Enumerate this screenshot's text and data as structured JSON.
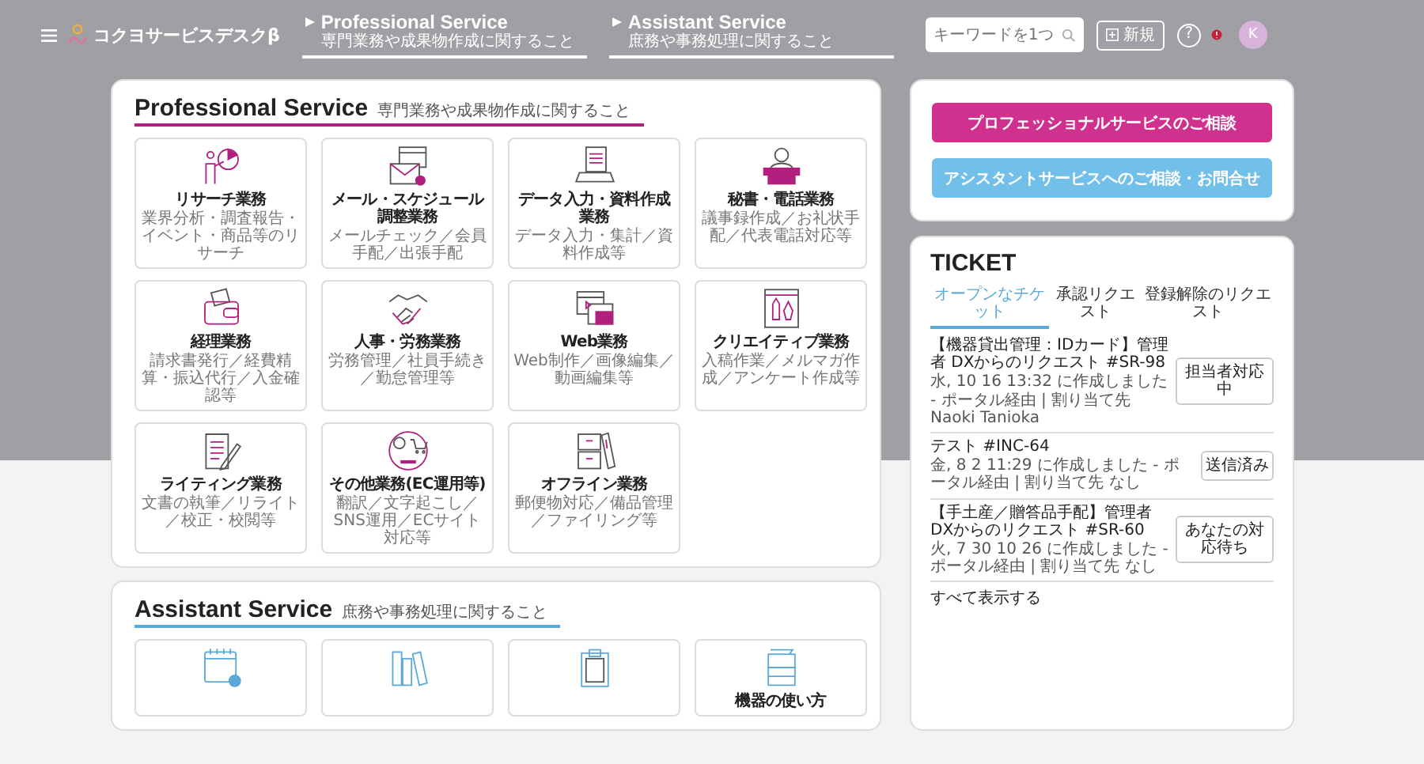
{
  "header": {
    "brand": "コクヨサービスデスクβ",
    "nav": [
      {
        "label": "Professional Service",
        "sub": "専門業務や成果物作成に関すること"
      },
      {
        "label": "Assistant Service",
        "sub": "庶務や事務処理に関すること"
      }
    ],
    "search": {
      "placeholder": "キーワードを1つ"
    },
    "new_button": "新規",
    "help": "?",
    "avatar": "K"
  },
  "sections": [
    {
      "title": "Professional Service",
      "sub": "専門業務や成果物作成に関すること",
      "color": "#b2207f",
      "cards": [
        {
          "kind": "research",
          "title": "リサーチ業務",
          "desc": "業界分析・調査報告・イベント・商品等のリサーチ"
        },
        {
          "kind": "mail",
          "title": "メール・スケジュール調整業務",
          "desc": "メールチェック／会員手配／出張手配"
        },
        {
          "kind": "data",
          "title": "データ入力・資料作成業務",
          "desc": "データ入力・集計／資料作成等"
        },
        {
          "kind": "secretary",
          "title": "秘書・電話業務",
          "desc": "議事録作成／お礼状手配／代表電話対応等"
        },
        {
          "kind": "accounting",
          "title": "経理業務",
          "desc": "請求書発行／経費精算・振込代行／入金確認等"
        },
        {
          "kind": "hr",
          "title": "人事・労務業務",
          "desc": "労務管理／社員手続き／勤怠管理等"
        },
        {
          "kind": "web",
          "title": "Web業務",
          "desc": "Web制作／画像編集／動画編集等"
        },
        {
          "kind": "creative",
          "title": "クリエイティブ業務",
          "desc": "入稿作業／メルマガ作成／アンケート作成等"
        },
        {
          "kind": "writing",
          "title": "ライティング業務",
          "desc": "文書の執筆／リライト／校正・校閲等"
        },
        {
          "kind": "other",
          "title": "その他業務(EC運用等)",
          "desc": "翻訳／文字起こし／SNS運用／ECサイト対応等"
        },
        {
          "kind": "offline",
          "title": "オフライン業務",
          "desc": "郵便物対応／備品管理／ファイリング等"
        }
      ]
    },
    {
      "title": "Assistant Service",
      "sub": "庶務や事務処理に関すること",
      "color": "#5aa9d6",
      "cards": [
        {
          "kind": "schedule"
        },
        {
          "kind": "filing"
        },
        {
          "kind": "clipboard"
        },
        {
          "kind": "copier",
          "title": "機器の使い方"
        }
      ]
    }
  ],
  "consult_buttons": [
    {
      "label": "プロフェッショナルサービスのご相談",
      "color": "#d0318f"
    },
    {
      "label": "アシスタントサービスへのご相談・お問合せ",
      "color": "#72c0ea"
    }
  ],
  "ticket": {
    "title": "TICKET",
    "tabs": [
      {
        "label": "オープンなチケット",
        "selected": true
      },
      {
        "label": "承認リクエスト",
        "selected": false
      },
      {
        "label": "登録解除のリクエスト",
        "selected": false
      }
    ],
    "items": [
      {
        "title": "【機器貸出管理：IDカード】管理者 DXからのリクエスト #SR-98",
        "meta": "水, 10 16 13:32 に作成しました - ポータル経由 | 割り当て先 Naoki Tanioka",
        "status": "担当者対応中"
      },
      {
        "title": "テスト #INC-64",
        "meta": "金, 8 2 11:29 に作成しました - ポータル経由 | 割り当て先 なし",
        "status": "送信済み"
      },
      {
        "title": "【手土産／贈答品手配】管理者 DXからのリクエスト #SR-60",
        "meta": "火, 7 30 10 26 に作成しました - ポータル経由 | 割り当て先 なし",
        "status": "あなたの対応待ち"
      }
    ],
    "show_all": "すべて表示する"
  }
}
